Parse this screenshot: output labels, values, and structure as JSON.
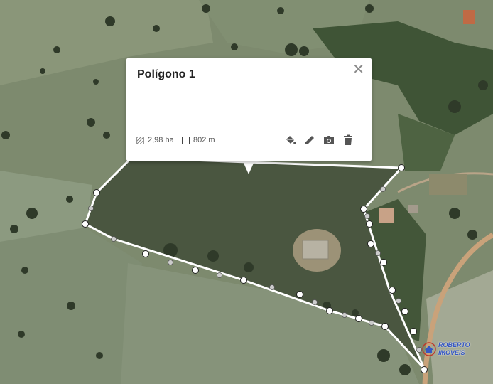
{
  "popup": {
    "title": "Polígono 1",
    "area_value": "2,98 ha",
    "perimeter_value": "802 m",
    "area_icon": "area-hatch-icon",
    "perimeter_icon": "square-outline-icon",
    "close_icon": "close-icon",
    "tools": [
      "paint-bucket-icon",
      "pencil-icon",
      "camera-icon",
      "trash-icon"
    ]
  },
  "watermark": {
    "line1": "ROBERTO",
    "line2": "IMOVEIS",
    "logo": "house-logo-icon"
  },
  "colors": {
    "polygon_stroke": "#ffffff",
    "vertex_fill": "#ffffff",
    "vertex_stroke": "#222222",
    "midpoint_fill": "#cccccc",
    "brand": "#3557c5",
    "road": "#c9a27a"
  }
}
